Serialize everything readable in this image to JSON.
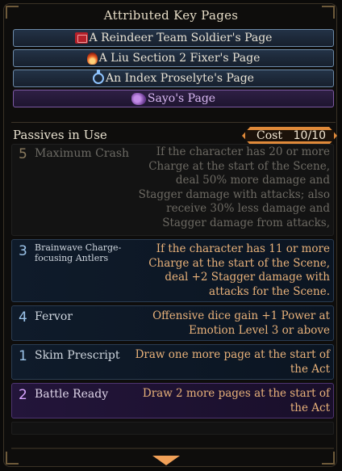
{
  "key_pages": {
    "title": "Attributed Key Pages",
    "items": [
      {
        "label": "A Reindeer Team Soldier's Page",
        "icon": "reindeer-team-icon",
        "style": "blue"
      },
      {
        "label": "A Liu Section 2 Fixer's Page",
        "icon": "liu-flame-icon",
        "style": "blue"
      },
      {
        "label": "An Index Proselyte's Page",
        "icon": "index-icon",
        "style": "blue"
      },
      {
        "label": "Sayo's Page",
        "icon": "sayo-icon",
        "style": "purple"
      }
    ]
  },
  "passives": {
    "title": "Passives in Use",
    "cost_label": "Cost",
    "cost_value": "10/10",
    "items": [
      {
        "cost": "5",
        "name": "Maximum Crash",
        "desc": [
          "If the character has 20 or more",
          "Charge at the start of the Scene,",
          "deal 50% more damage and",
          "Stagger damage with attacks; also",
          "receive 30% less damage and",
          "Stagger damage from attacks,"
        ],
        "style": "dim"
      },
      {
        "cost": "3",
        "name": "Brainwave Charge-focusing Antlers",
        "desc": [
          "If the character has 11 or more",
          "Charge at the start of the Scene,",
          "deal +2 Stagger damage with",
          "attacks for the Scene."
        ],
        "style": "blue"
      },
      {
        "cost": "4",
        "name": "Fervor",
        "desc": [
          "Offensive dice gain +1 Power at",
          "Emotion Level 3 or above"
        ],
        "style": "blue"
      },
      {
        "cost": "1",
        "name": "Skim Prescript",
        "desc": [
          "Draw one more page at the start of",
          "the Act"
        ],
        "style": "blue"
      },
      {
        "cost": "2",
        "name": "Battle Ready",
        "desc": [
          "Draw 2 more pages at the start of",
          "the Act"
        ],
        "style": "purple"
      }
    ]
  },
  "colors": {
    "accent_orange": "#e08a3a",
    "desc_text": "#e9b27a",
    "key_page_border": "#6c8aa8",
    "purple": "#7d5aa3"
  }
}
